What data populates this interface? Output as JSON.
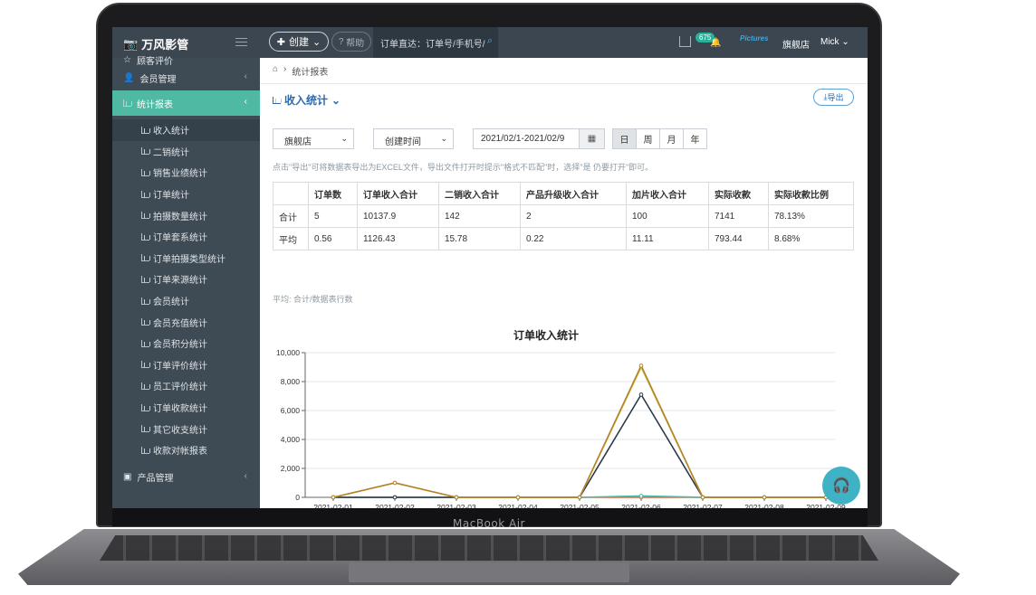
{
  "device": {
    "brand": "MacBook Air"
  },
  "app": {
    "logo": "万风影管",
    "create_label": "创建",
    "help_label": "帮助",
    "order_search": "订单直达：订单号/手机号/",
    "badge_count": "675",
    "store": "旗舰店",
    "user": "Mick",
    "avatar_brand": "Pictures"
  },
  "sidebar": {
    "top_partial": "顾客评价",
    "member": "会员管理",
    "stats": "统计报表",
    "product": "产品管理",
    "sub_items": [
      "收入统计",
      "二销统计",
      "销售业绩统计",
      "订单统计",
      "拍摄数量统计",
      "订单套系统计",
      "订单拍摄类型统计",
      "订单来源统计",
      "会员统计",
      "会员充值统计",
      "会员积分统计",
      "订单评价统计",
      "员工评价统计",
      "订单收款统计",
      "其它收支统计",
      "收款对帐报表"
    ]
  },
  "content": {
    "crumb": "统计报表",
    "page_title": "收入统计",
    "export_label": "导出",
    "store_select": "旗舰店",
    "time_select": "创建时间",
    "date_range": "2021/02/1-2021/02/9",
    "periods": [
      "日",
      "周",
      "月",
      "年"
    ],
    "tip": "点击\"导出\"可将数据表导出为EXCEL文件，导出文件打开时提示\"格式不匹配\"时，选择\"是 仍要打开\"即可。",
    "table": {
      "headers": [
        "",
        "订单数",
        "订单收入合计",
        "二销收入合计",
        "产品升级收入合计",
        "加片收入合计",
        "实际收款",
        "实际收款比例"
      ],
      "rows": [
        [
          "合计",
          "5",
          "10137.9",
          "142",
          "2",
          "100",
          "7141",
          "78.13%"
        ],
        [
          "平均",
          "0.56",
          "1126.43",
          "15.78",
          "0.22",
          "11.11",
          "793.44",
          "8.68%"
        ]
      ]
    },
    "avg_note": "平均: 合计/数据表行数"
  },
  "chart_data": {
    "type": "line",
    "title": "订单收入统计",
    "categories": [
      "2021-02-01",
      "2021-02-02",
      "2021-02-03",
      "2021-02-04",
      "2021-02-05",
      "2021-02-06",
      "2021-02-07",
      "2021-02-08",
      "2021-02-09"
    ],
    "ylim": [
      0,
      10000
    ],
    "yticks": [
      "0",
      "2,000",
      "4,000",
      "6,000",
      "8,000",
      "10,000"
    ],
    "series": [
      {
        "color": "#b5832d",
        "values": [
          0,
          1000,
          0,
          0,
          0,
          9100,
          0,
          0,
          0
        ]
      },
      {
        "color": "#c8c230",
        "values": [
          0,
          1000,
          0,
          0,
          0,
          9000,
          0,
          0,
          0
        ]
      },
      {
        "color": "#2b3a4a",
        "values": [
          0,
          0,
          0,
          0,
          0,
          7100,
          0,
          0,
          0
        ]
      },
      {
        "color": "#4fb9a3",
        "values": [
          0,
          0,
          0,
          0,
          0,
          100,
          0,
          0,
          0
        ]
      },
      {
        "color": "#d06a4a",
        "values": [
          0,
          0,
          0,
          0,
          0,
          0,
          0,
          0,
          0
        ]
      }
    ]
  }
}
